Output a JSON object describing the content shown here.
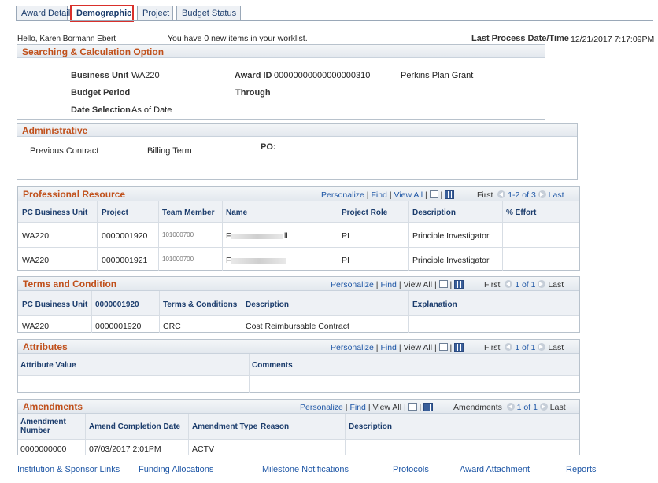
{
  "tabs": [
    {
      "label": "Award Detail",
      "active": false
    },
    {
      "label": "Demographic",
      "active": true
    },
    {
      "label": "Project",
      "active": false
    },
    {
      "label": "Budget Status",
      "active": false
    }
  ],
  "header": {
    "hello": "Hello, Karen Bormann Ebert",
    "worklist": "You have 0 new items in your worklist.",
    "last_process_label": "Last Process Date/Time",
    "last_process_value": "12/21/2017  7:17:09PM"
  },
  "search_calc": {
    "title": "Searching & Calculation Option",
    "business_unit_label": "Business Unit",
    "business_unit_value": "WA220",
    "award_id_label": "Award ID",
    "award_id_value": "00000000000000000310",
    "award_name": "Perkins Plan Grant",
    "budget_period_label": "Budget Period",
    "through_label": "Through",
    "date_selection_label": "Date Selection",
    "date_selection_value": "As of Date"
  },
  "administrative": {
    "title": "Administrative",
    "previous_contract": "Previous Contract",
    "billing_term": "Billing Term",
    "po_label": "PO:"
  },
  "grid_tools": {
    "personalize": "Personalize",
    "find": "Find",
    "view_all": "View All",
    "first": "First",
    "last": "Last",
    "sep": "|"
  },
  "professional_resource": {
    "title": "Professional Resource",
    "range": "1-2 of 3",
    "columns": [
      "PC Business Unit",
      "Project",
      "Team Member",
      "Name",
      "Project Role",
      "Description",
      "% Effort"
    ],
    "rows": [
      {
        "bu": "WA220",
        "project": "0000001920",
        "member": "101000700",
        "name": "F",
        "name_end": "ll",
        "role": "PI",
        "desc": "Principle Investigator"
      },
      {
        "bu": "WA220",
        "project": "0000001921",
        "member": "101000700",
        "name": "F",
        "name_end": "",
        "role": "PI",
        "desc": "Principle Investigator"
      }
    ]
  },
  "terms": {
    "title": "Terms and Condition",
    "range": "1 of 1",
    "columns": [
      "PC Business Unit",
      "0000001920",
      "Terms & Conditions",
      "Description",
      "Explanation"
    ],
    "rows": [
      {
        "bu": "WA220",
        "project": "0000001920",
        "term": "CRC",
        "desc": "Cost Reimbursable Contract"
      }
    ]
  },
  "attributes": {
    "title": "Attributes",
    "range": "1 of 1",
    "columns": [
      "Attribute Value",
      "Comments"
    ]
  },
  "amendments": {
    "title": "Amendments",
    "nav_label": "Amendments",
    "range": "1 of 1",
    "columns": [
      "Amendment Number",
      "Amend Completion Date",
      "Amendment Type",
      "Reason",
      "Description"
    ],
    "rows": [
      {
        "number": "0000000000",
        "date": "07/03/2017  2:01PM",
        "type": "ACTV"
      }
    ]
  },
  "bottom_links": [
    "Institution & Sponsor Links",
    "Funding Allocations",
    "Milestone Notifications",
    "Protocols",
    "Award Attachment",
    "Reports"
  ],
  "colors": {
    "accent_orange": "#c0501b",
    "link_blue": "#1f57a6",
    "active_tab_border": "#d9302b"
  }
}
